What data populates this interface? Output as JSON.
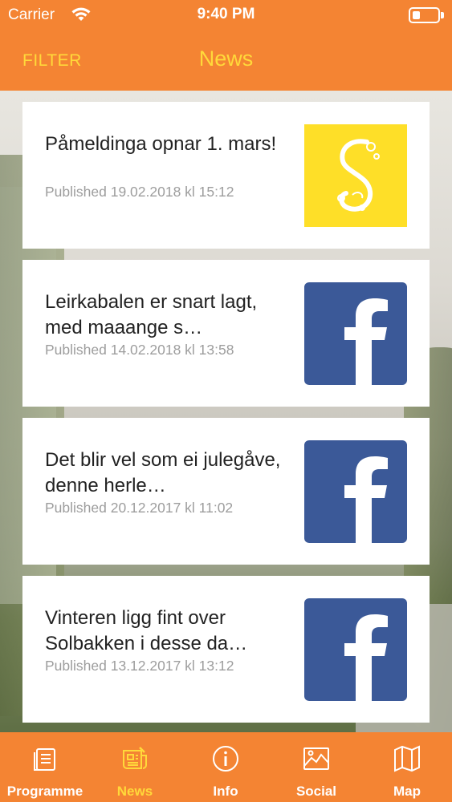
{
  "status": {
    "carrier": "Carrier",
    "time": "9:40 PM"
  },
  "nav": {
    "filter_label": "FILTER",
    "title": "News"
  },
  "colors": {
    "brand_orange": "#f48433",
    "accent_yellow": "#ffd93a",
    "facebook_blue": "#3b5998"
  },
  "news": [
    {
      "title": "Påmeldinga opnar 1. mars!",
      "published": "Published 19.02.2018 kl 15:12",
      "icon": "solbakken-logo-icon"
    },
    {
      "title": "Leirkabalen er snart lagt, med maaange s…",
      "published": "Published 14.02.2018 kl 13:58",
      "icon": "facebook-icon"
    },
    {
      "title": "Det blir vel som ei julegåve, denne herle…",
      "published": "Published 20.12.2017 kl 11:02",
      "icon": "facebook-icon"
    },
    {
      "title": "Vinteren ligg fint over Solbakken i desse da…",
      "published": "Published 13.12.2017 kl 13:12",
      "icon": "facebook-icon"
    }
  ],
  "tabs": [
    {
      "label": "Programme",
      "icon": "programme-icon",
      "active": false
    },
    {
      "label": "News",
      "icon": "news-icon",
      "active": true
    },
    {
      "label": "Info",
      "icon": "info-icon",
      "active": false
    },
    {
      "label": "Social",
      "icon": "social-icon",
      "active": false
    },
    {
      "label": "Map",
      "icon": "map-icon",
      "active": false
    }
  ]
}
